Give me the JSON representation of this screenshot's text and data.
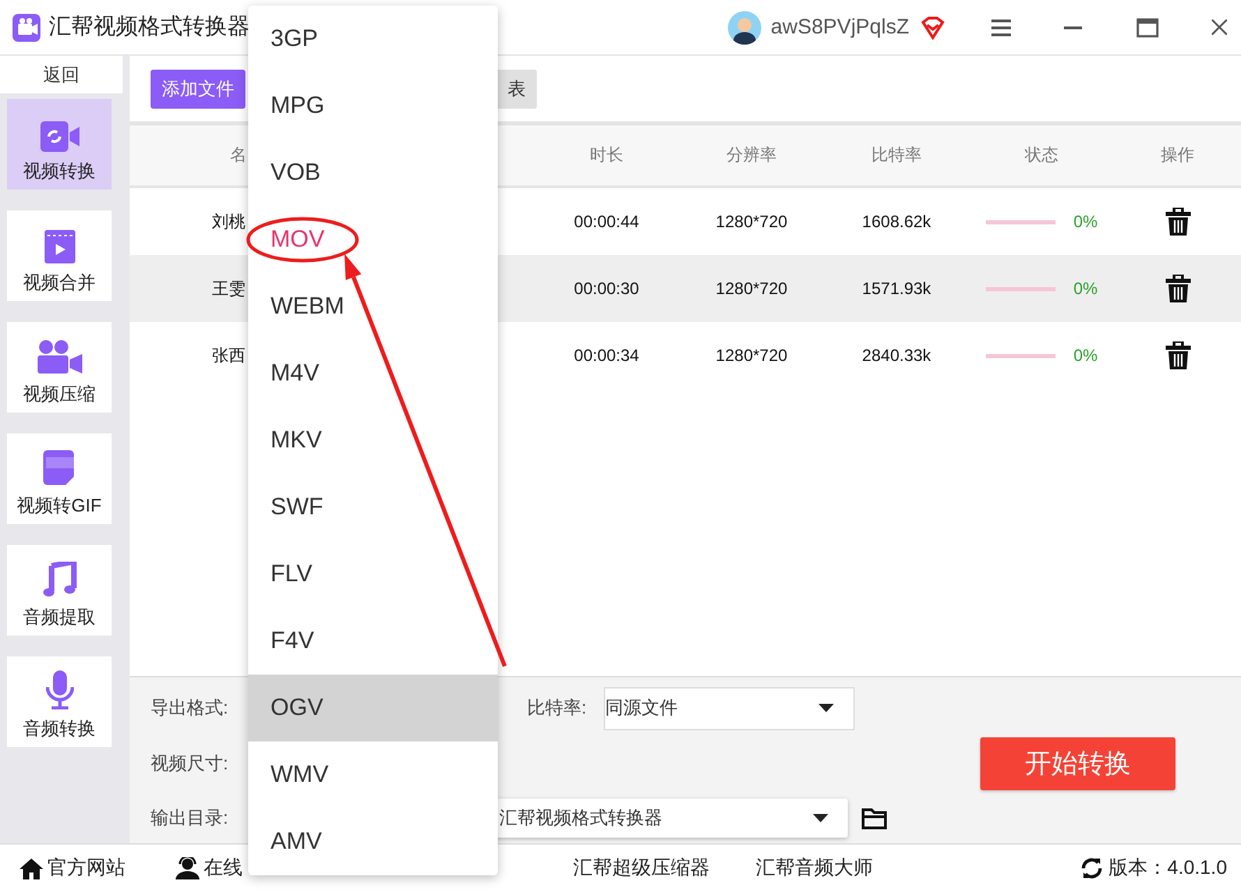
{
  "window": {
    "title": "汇帮视频格式转换器",
    "user": "awS8PVjPqlsZ"
  },
  "sidebar": {
    "back": "返回",
    "items": [
      {
        "label": "视频转换",
        "kind": "convert",
        "selected": true
      },
      {
        "label": "视频合并",
        "kind": "merge",
        "selected": false
      },
      {
        "label": "视频压缩",
        "kind": "compress",
        "selected": false
      },
      {
        "label": "视频转GIF",
        "kind": "gif",
        "selected": false
      },
      {
        "label": "音频提取",
        "kind": "music",
        "selected": false
      },
      {
        "label": "音频转换",
        "kind": "mic",
        "selected": false
      }
    ]
  },
  "toolbar": {
    "buttons": [
      {
        "label": "添加文件",
        "kind": "primary"
      },
      {
        "label": "表",
        "kind": "secondary"
      }
    ]
  },
  "table": {
    "columns": [
      "名",
      "时长",
      "分辨率",
      "比特率",
      "状态",
      "操作"
    ],
    "rows": [
      {
        "name": "刘桃",
        "duration": "00:00:44",
        "resolution": "1280*720",
        "bitrate": "1608.62k",
        "level": 0,
        "progress": "0%",
        "selected": false
      },
      {
        "name": "王雯",
        "duration": "00:00:30",
        "resolution": "1280*720",
        "bitrate": "1571.93k",
        "level": 0,
        "progress": "0%",
        "selected": true
      },
      {
        "name": "张西",
        "duration": "00:00:34",
        "resolution": "1280*720",
        "bitrate": "2840.33k",
        "level": 0,
        "progress": "0%",
        "selected": false
      }
    ]
  },
  "settings": {
    "format_label": "导出格式:",
    "bitrate_label": "比特率:",
    "bitrate_value": "同源文件",
    "size_label": "视频尺寸:",
    "output_label": "输出目录:",
    "output_value": "汇帮视频格式转换器",
    "start_button": "开始转换"
  },
  "footer": {
    "links": [
      {
        "label": "官方网站",
        "kind": "home"
      },
      {
        "label": "在线",
        "kind": "support"
      },
      {
        "label": "汇帮超级压缩器",
        "kind": "plain"
      },
      {
        "label": "汇帮音频大师",
        "kind": "plain"
      }
    ],
    "version": "版本：4.0.1.0"
  },
  "format_menu": {
    "items": [
      {
        "label": "3GP",
        "selected": false,
        "circled": false
      },
      {
        "label": "MPG",
        "selected": false,
        "circled": false
      },
      {
        "label": "VOB",
        "selected": false,
        "circled": false
      },
      {
        "label": "MOV",
        "selected": false,
        "circled": true
      },
      {
        "label": "WEBM",
        "selected": false,
        "circled": false
      },
      {
        "label": "M4V",
        "selected": false,
        "circled": false
      },
      {
        "label": "MKV",
        "selected": false,
        "circled": false
      },
      {
        "label": "SWF",
        "selected": false,
        "circled": false
      },
      {
        "label": "FLV",
        "selected": false,
        "circled": false
      },
      {
        "label": "F4V",
        "selected": false,
        "circled": false
      },
      {
        "label": "OGV",
        "selected": true,
        "circled": false
      },
      {
        "label": "WMV",
        "selected": false,
        "circled": false
      },
      {
        "label": "AMV",
        "selected": false,
        "circled": false
      }
    ]
  }
}
